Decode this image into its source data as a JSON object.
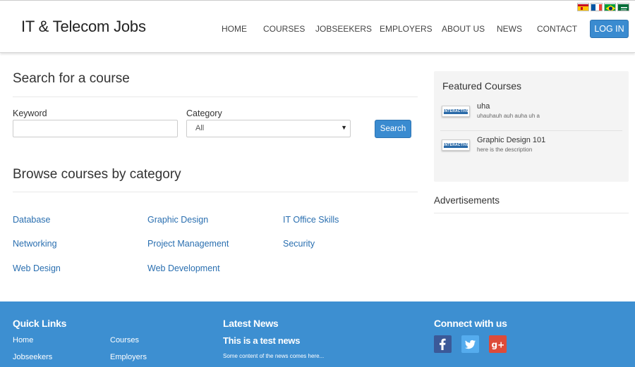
{
  "header": {
    "brand": "IT & Telecom Jobs",
    "nav": [
      "HOME",
      "COURSES",
      "JOBSEEKERS",
      "EMPLOYERS",
      "ABOUT US",
      "NEWS",
      "CONTACT"
    ],
    "login_label": "LOG IN",
    "flags": [
      "spain-flag-icon",
      "france-flag-icon",
      "brazil-flag-icon",
      "saudi-arabia-flag-icon"
    ]
  },
  "search": {
    "title": "Search for a course",
    "keyword_label": "Keyword",
    "keyword_value": "",
    "keyword_placeholder": "",
    "category_label": "Category",
    "category_value": "All",
    "search_label": "Search"
  },
  "browse": {
    "title": "Browse courses by category",
    "categories": [
      "Database",
      "Graphic Design",
      "IT Office Skills",
      "Networking",
      "Project Management",
      "Security",
      "Web Design",
      "Web Development"
    ]
  },
  "sidebar": {
    "featured_title": "Featured Courses",
    "courses": [
      {
        "name": "uha",
        "description": "uhauhauh auh auha uh a",
        "thumb_text": "INTERACTIVE"
      },
      {
        "name": "Graphic Design 101",
        "description": "here is the description",
        "thumb_text": "INTERACTIVE"
      }
    ],
    "ads_title": "Advertisements"
  },
  "footer": {
    "quick_links_title": "Quick Links",
    "links": [
      "Home",
      "Courses",
      "Jobseekers",
      "Employers"
    ],
    "news_title": "Latest News",
    "news_item_title": "This is a test news",
    "news_item_body": "Some content of the news comes here...",
    "connect_title": "Connect with us",
    "social": [
      "facebook-icon",
      "twitter-icon",
      "google-plus-icon"
    ]
  },
  "colors": {
    "accent": "#3a8bd0",
    "footer_bg": "#3d8fd1",
    "link": "#2a6fb0",
    "facebook": "#3b5998",
    "twitter": "#55acee",
    "google_plus": "#dd4b39"
  }
}
